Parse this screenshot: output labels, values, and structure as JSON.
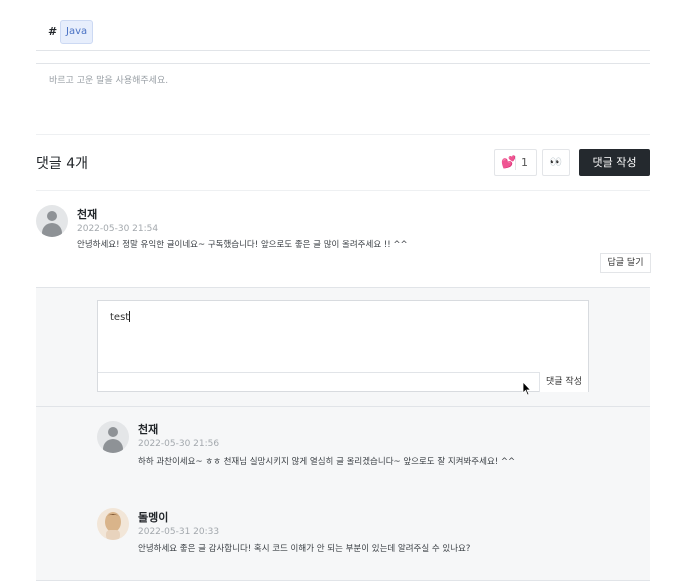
{
  "tags": {
    "hash": "#",
    "items": [
      "Java"
    ]
  },
  "notice": "바르고 고운 말을 사용해주세요.",
  "comments_header": {
    "title": "댓글 4개",
    "like_count": "1",
    "like_icon": "heart-icon",
    "eyes_icon": "eyes-icon",
    "eyes_glyph": "👀",
    "write_label": "댓글 작성"
  },
  "comment": {
    "author": "천재",
    "date": "2022-05-30 21:54",
    "text": "안녕하세요! 정말 유익한 글이네요~ 구독했습니다! 앞으로도 좋은 글 많이 올려주세요 !! ^^",
    "reply_label": "답글 달기"
  },
  "reply_form": {
    "value": "test",
    "submit_label": "댓글 작성"
  },
  "replies": [
    {
      "author": "천재",
      "date": "2022-05-30 21:56",
      "text": "하하 과찬이세요~ ㅎㅎ 천재님 실망시키지 않게 열심히 글 올리겠습니다~ 앞으로도 잘 지켜봐주세요! ^^"
    },
    {
      "author": "돌멩이",
      "date": "2022-05-31 20:33",
      "text": "안녕하세요 좋은 글 감사합니다! 혹시 코드 이해가 안 되는 부분이 있는데 알려주실 수 있나요?"
    }
  ]
}
